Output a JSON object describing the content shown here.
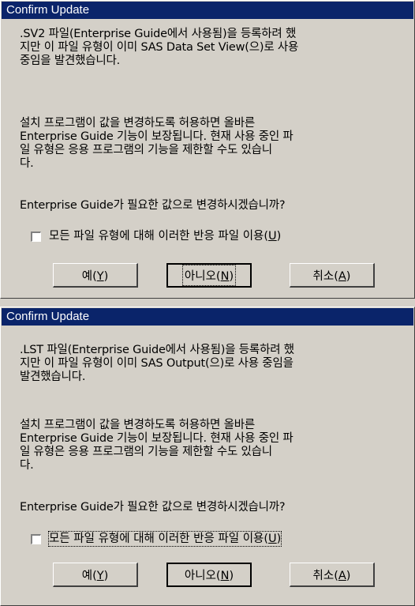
{
  "dialogs": [
    {
      "title": "Confirm Update",
      "message1": ".SV2 파일(Enterprise Guide에서 사용됨)을 등록하려 했\n지만 이 파일 유형이 이미 SAS Data Set View(으)로 사용\n중임을 발견했습니다.",
      "message2": "설치 프로그램이 값을 변경하도록 허용하면 올바른\nEnterprise Guide 기능이 보장됩니다. 현재 사용 중인 파\n일 유형은 응용 프로그램의 기능을 제한할 수도 있습니\n다.",
      "question": "Enterprise Guide가 필요한 값으로 변경하시겠습니까?",
      "checkbox": {
        "label_pre": "모든 파일 유형에 대해 이러한 반응 파일 이용(",
        "mnemonic": "U",
        "label_post": ")",
        "checked": false
      },
      "buttons": [
        {
          "pre": "예(",
          "mnemonic": "Y",
          "post": ")"
        },
        {
          "pre": "아니오(",
          "mnemonic": "N",
          "post": ")"
        },
        {
          "pre": "취소(",
          "mnemonic": "A",
          "post": ")"
        }
      ]
    },
    {
      "title": "Confirm Update",
      "message1": ".LST 파일(Enterprise Guide에서 사용됨)을 등록하려 했\n지만 이 파일 유형이 이미 SAS Output(으)로 사용 중임을\n발견했습니다.",
      "message2": "설치 프로그램이 값을 변경하도록 허용하면 올바른\nEnterprise Guide 기능이 보장됩니다. 현재 사용 중인 파\n일 유형은 응용 프로그램의 기능을 제한할 수도 있습니\n다.",
      "question": "Enterprise Guide가 필요한 값으로 변경하시겠습니까?",
      "checkbox": {
        "label_pre": "모든 파일 유형에 대해 이러한 반응 파일 이용(",
        "mnemonic": "U",
        "label_post": ")",
        "checked": false
      },
      "buttons": [
        {
          "pre": "예(",
          "mnemonic": "Y",
          "post": ")"
        },
        {
          "pre": "아니오(",
          "mnemonic": "N",
          "post": ")"
        },
        {
          "pre": "취소(",
          "mnemonic": "A",
          "post": ")"
        }
      ]
    }
  ]
}
